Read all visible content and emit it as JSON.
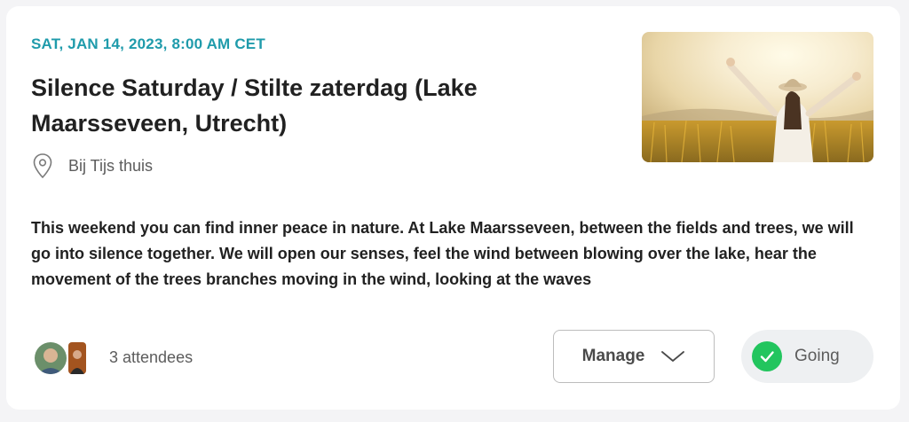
{
  "event": {
    "date": "SAT, JAN 14, 2023, 8:00 AM CET",
    "title": "Silence Saturday / Stilte zaterdag (Lake Maarsseveen, Utrecht)",
    "location": "Bij Tijs thuis",
    "description": "This weekend you can find inner peace in nature. At Lake Maarsseveen, between the fields and trees, we will go into silence together. We will open our senses, feel the wind between blowing over the lake, hear the movement of the trees branches moving in the wind, looking at the waves"
  },
  "attendees": {
    "count_label": "3 attendees"
  },
  "actions": {
    "manage_label": "Manage",
    "going_label": "Going"
  },
  "colors": {
    "date_accent": "#1f9bab",
    "going_check": "#22c55e"
  },
  "icons": {
    "location": "map-pin-icon",
    "manage": "chevron-down-icon",
    "going": "check-circle-icon"
  }
}
